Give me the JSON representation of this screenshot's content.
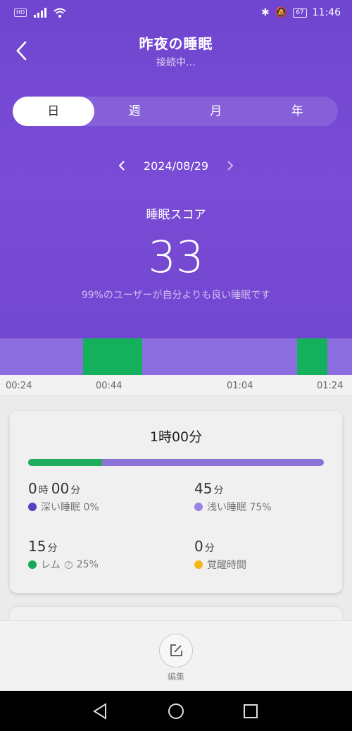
{
  "status": {
    "time": "11:46",
    "battery": "67",
    "hd": "HD"
  },
  "header": {
    "title": "昨夜の睡眠",
    "subtitle": "接続中…"
  },
  "tabs": [
    {
      "label": "日",
      "active": true
    },
    {
      "label": "週"
    },
    {
      "label": "月"
    },
    {
      "label": "年"
    }
  ],
  "date": {
    "value": "2024/08/29"
  },
  "score": {
    "label": "睡眠スコア",
    "value": "33",
    "note": "99%のユーザーが自分よりも良い睡眠です"
  },
  "timeline": {
    "ticks": [
      "00:24",
      "00:44",
      "01:04",
      "01:24"
    ]
  },
  "summary": {
    "total": "1時00分",
    "light_ratio_bar": 0.25,
    "stats": {
      "deep": {
        "h": "0",
        "h_unit": "時",
        "m": "00",
        "m_unit": "分",
        "label": "深い睡眠 0%",
        "color": "#5a3fc0"
      },
      "light": {
        "m": "45",
        "m_unit": "分",
        "label": "浅い睡眠 75%",
        "color": "#9a82e2"
      },
      "rem": {
        "m": "15",
        "m_unit": "分",
        "label": "レム",
        "pct": "25%",
        "color": "#16a955"
      },
      "awake": {
        "m": "0",
        "m_unit": "分",
        "label": "覚醒時間",
        "color": "#f4b71a"
      }
    }
  },
  "edit": {
    "label": "編集"
  }
}
